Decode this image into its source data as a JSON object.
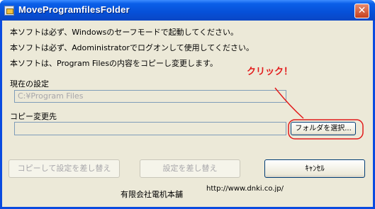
{
  "window": {
    "title": "MoveProgramfilesFolder",
    "close_symbol": "✕"
  },
  "messages": [
    "本ソフトは必ず、Windowsのセーフモードで起動してください。",
    "本ソフトは必ず、Adoministratorでログオンして使用してください。",
    "本ソフトは、Program Filesの内容をコピーし変更します。"
  ],
  "current_setting": {
    "label": "現在の設定",
    "value": "C:¥Program Files"
  },
  "destination": {
    "label": "コピー変更先",
    "value": ""
  },
  "buttons": {
    "select_folder": "フォルダを選択...",
    "copy_replace": "コピーして設定を差し替え",
    "replace": "設定を差し替え",
    "cancel": "ｷｬﾝｾﾙ"
  },
  "annotation": {
    "text": "クリック！",
    "color": "#e21b1b"
  },
  "footer": {
    "company": "有限会社電机本舗",
    "url": "http://www.dnki.co.jp/"
  }
}
